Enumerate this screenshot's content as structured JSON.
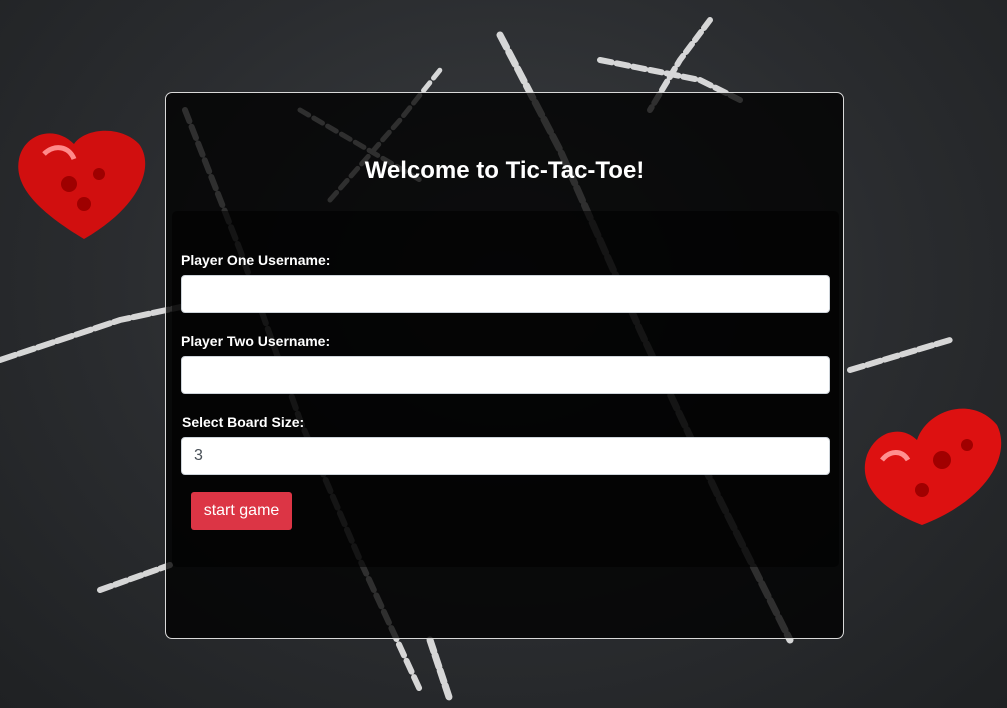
{
  "welcome": {
    "title": "Welcome to Tic-Tac-Toe!"
  },
  "form": {
    "player_one": {
      "label": "Player One Username:",
      "value": ""
    },
    "player_two": {
      "label": "Player Two Username:",
      "value": ""
    },
    "board_size": {
      "label": "Select Board Size:",
      "value": "3"
    },
    "start_label": "start game"
  },
  "colors": {
    "accent": "#dc3545",
    "background": "#2a2c2f",
    "heart": "#e01010"
  }
}
